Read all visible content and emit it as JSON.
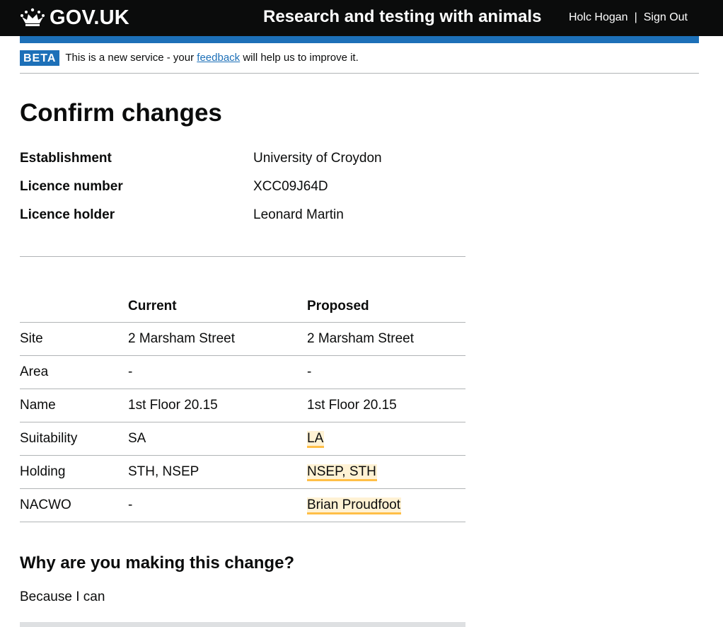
{
  "header": {
    "logo_text": "GOV.UK",
    "service_name": "Research and testing with animals",
    "user_name": "Holc Hogan",
    "separator": "|",
    "sign_out": "Sign Out"
  },
  "phase_banner": {
    "tag": "BETA",
    "text_before": "This is a new service - your",
    "link": "feedback",
    "text_after": "will help us to improve it."
  },
  "page": {
    "title": "Confirm changes"
  },
  "summary": [
    {
      "key": "Establishment",
      "value": "University of Croydon"
    },
    {
      "key": "Licence number",
      "value": "XCC09J64D"
    },
    {
      "key": "Licence holder",
      "value": "Leonard Martin"
    }
  ],
  "changes_table": {
    "headers": [
      "",
      "Current",
      "Proposed"
    ],
    "rows": [
      {
        "label": "Site",
        "current": "2 Marsham Street",
        "proposed": "2 Marsham Street",
        "changed": false
      },
      {
        "label": "Area",
        "current": "-",
        "proposed": "-",
        "changed": false
      },
      {
        "label": "Name",
        "current": "1st Floor 20.15",
        "proposed": "1st Floor 20.15",
        "changed": false
      },
      {
        "label": "Suitability",
        "current": "SA",
        "proposed": "LA",
        "changed": true
      },
      {
        "label": "Holding",
        "current": "STH, NSEP",
        "proposed": "NSEP, STH",
        "changed": true
      },
      {
        "label": "NACWO",
        "current": "-",
        "proposed": "Brian Proudfoot",
        "changed": true
      }
    ]
  },
  "reason": {
    "heading": "Why are you making this change?",
    "text": "Because I can"
  },
  "colors": {
    "header_bg": "#0b0c0c",
    "brand_blue": "#1d70b8",
    "highlight_bg": "#fff2d4",
    "highlight_border": "#ffbf47",
    "border": "#b1b4b6"
  },
  "icons": {
    "logo": "crown-icon"
  }
}
